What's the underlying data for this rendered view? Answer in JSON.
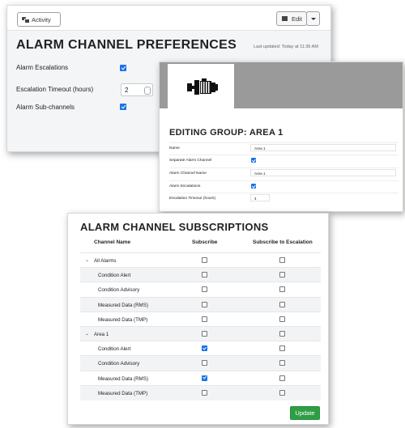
{
  "preferences": {
    "activity_label": "Activity",
    "edit_label": "Edit",
    "title": "ALARM CHANNEL PREFERENCES",
    "last_updated": "Last updated: Today at 11:36 AM",
    "rows": [
      {
        "label": "Alarm Escalations",
        "checked": true
      },
      {
        "label": "Escalation Timeout (hours)",
        "value": "2"
      },
      {
        "label": "Alarm Sub-channels",
        "checked": true
      }
    ]
  },
  "editing_group": {
    "title": "EDITING GROUP: AREA 1",
    "icon": "motor-icon",
    "fields": [
      {
        "label": "Name",
        "value": "Area 1"
      },
      {
        "label": "Separate Alarm Channel",
        "checked": true
      },
      {
        "label": "Alarm Channel Name",
        "value": "Area 1"
      },
      {
        "label": "Alarm Escalations",
        "checked": true
      },
      {
        "label": "Escalation Timeout (hours)",
        "value": "4"
      }
    ]
  },
  "subscriptions": {
    "title": "ALARM CHANNEL SUBSCRIPTIONS",
    "columns": [
      "Channel Name",
      "Subscribe",
      "Subscribe to Escalation"
    ],
    "rows": [
      {
        "name": "All Alarms",
        "group": true,
        "subscribe": false,
        "escalation": false
      },
      {
        "name": "Condition Alert",
        "group": false,
        "subscribe": false,
        "escalation": false
      },
      {
        "name": "Condition Advisory",
        "group": false,
        "subscribe": false,
        "escalation": false
      },
      {
        "name": "Measured Data (RMS)",
        "group": false,
        "subscribe": false,
        "escalation": false
      },
      {
        "name": "Measured Data (TMP)",
        "group": false,
        "subscribe": false,
        "escalation": false
      },
      {
        "name": "Area 1",
        "group": true,
        "subscribe": false,
        "escalation": false
      },
      {
        "name": "Condition Alert",
        "group": false,
        "subscribe": true,
        "escalation": false
      },
      {
        "name": "Condition Advisory",
        "group": false,
        "subscribe": false,
        "escalation": false
      },
      {
        "name": "Measured Data (RMS)",
        "group": false,
        "subscribe": true,
        "escalation": false
      },
      {
        "name": "Measured Data (TMP)",
        "group": false,
        "subscribe": false,
        "escalation": false
      }
    ],
    "update_label": "Update",
    "update_color": "#2e9e44"
  }
}
